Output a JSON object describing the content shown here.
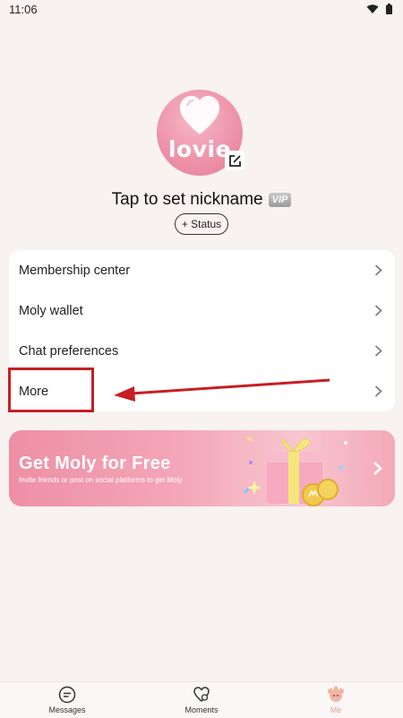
{
  "status_bar": {
    "time": "11:06"
  },
  "profile": {
    "avatar_text": "lovie",
    "nickname": "Tap to set nickname",
    "vip_label": "VIP",
    "status_button": "+ Status"
  },
  "menu": {
    "items": [
      {
        "label": "Membership center"
      },
      {
        "label": "Moly wallet"
      },
      {
        "label": "Chat preferences"
      },
      {
        "label": "More"
      }
    ]
  },
  "banner": {
    "title": "Get Moly for Free",
    "subtitle": "Invite friends or post on social platforms to get Moly"
  },
  "bottom_nav": {
    "items": [
      {
        "label": "Messages"
      },
      {
        "label": "Moments"
      },
      {
        "label": "Me"
      }
    ]
  },
  "colors": {
    "background": "#f8f2f1",
    "highlight": "#c51f24",
    "banner_pink": "#ee8fa5",
    "active_tab": "#e6a092"
  }
}
